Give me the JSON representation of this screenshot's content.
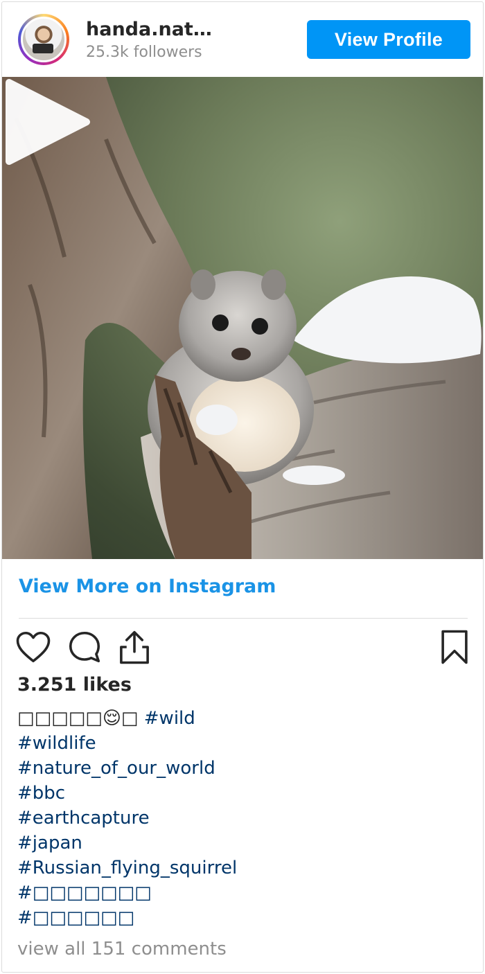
{
  "header": {
    "username": "handa.nat…",
    "followers": "25.3k followers",
    "view_profile_label": "View Profile"
  },
  "post": {
    "view_more_label": "View More on Instagram",
    "likes": "3.251 likes",
    "caption_prefix": "□□□□□😌□",
    "hashtags": [
      "#wild",
      "#wildlife",
      "#nature_of_our_world",
      "#bbc",
      "#earthcapture",
      "#japan",
      "#Russian_flying_squirrel",
      "#□□□□□□□",
      "#□□□□□□"
    ],
    "comments_link": "view all 151 comments"
  },
  "icons": {
    "avatar": "avatar",
    "play": "play-icon",
    "like": "heart-icon",
    "comment": "comment-icon",
    "share": "share-icon",
    "save": "bookmark-icon"
  },
  "colors": {
    "brand_blue": "#0095f6",
    "link_blue": "#1a93e6",
    "hashtag": "#003569",
    "muted": "#8e8e8e"
  }
}
